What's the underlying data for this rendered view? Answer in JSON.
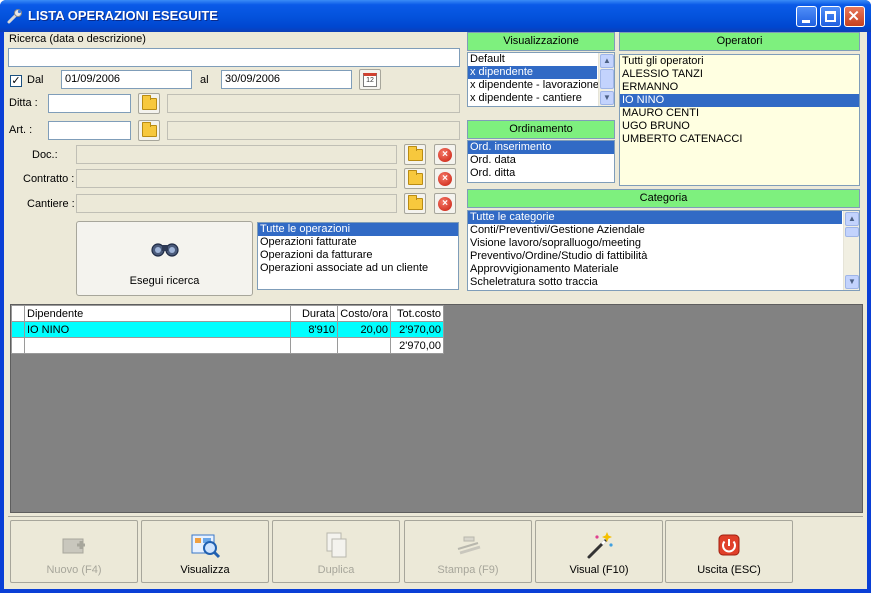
{
  "window": {
    "title": "LISTA OPERAZIONI ESEGUITE"
  },
  "search": {
    "label": "Ricerca (data o descrizione)",
    "value": "",
    "dal_label": "Dal",
    "dal_checked": true,
    "check_mark": "✓",
    "date_from": "01/09/2006",
    "al_label": "al",
    "date_to": "30/09/2006",
    "calendar_day": "12",
    "ditta_label": "Ditta :",
    "art_label": "Art. :",
    "doc_label": "Doc.:",
    "contratto_label": "Contratto :",
    "cantiere_label": "Cantiere :",
    "delete_glyph": "×",
    "esegui_label": "Esegui ricerca"
  },
  "filter_list": [
    "Tutte le operazioni",
    "Operazioni fatturate",
    "Operazioni da fatturare",
    "Operazioni associate ad un cliente"
  ],
  "visualizzazione": {
    "header": "Visualizzazione",
    "items": [
      "Default",
      "x dipendente",
      "x dipendente - lavorazione",
      "x dipendente - cantiere"
    ],
    "selected": 1
  },
  "ordinamento": {
    "header": "Ordinamento",
    "items": [
      "Ord. inserimento",
      "Ord. data",
      "Ord. ditta"
    ],
    "selected": 0
  },
  "operatori": {
    "header": "Operatori",
    "items": [
      "Tutti gli operatori",
      "ALESSIO TANZI",
      "ERMANNO",
      "IO   NINO",
      "MAURO CENTI",
      "UGO BRUNO",
      "UMBERTO CATENACCI"
    ],
    "selected": 3
  },
  "categoria": {
    "header": "Categoria",
    "items": [
      "Tutte le categorie",
      "Conti/Preventivi/Gestione Aziendale",
      "Visione lavoro/sopralluogo/meeting",
      "Preventivo/Ordine/Studio di fattibilità",
      "Approvvigionamento Materiale",
      "Scheletratura sotto traccia"
    ],
    "selected": 0
  },
  "scroll": {
    "up": "▲",
    "down": "▼"
  },
  "grid": {
    "columns": [
      "Dipendente",
      "Durata",
      "Costo/ora",
      "Tot.costo"
    ],
    "rows": [
      {
        "dipendente": "IO   NINO",
        "durata": "8'910",
        "costo": "20,00",
        "tot": "2'970,00"
      },
      {
        "dipendente": "",
        "durata": "",
        "costo": "",
        "tot": "2'970,00"
      }
    ]
  },
  "toolbar": {
    "nuovo": "Nuovo (F4)",
    "visualizza": "Visualizza",
    "duplica": "Duplica",
    "stampa": "Stampa (F9)",
    "visual": "Visual (F10)",
    "uscita": "Uscita (ESC)"
  }
}
